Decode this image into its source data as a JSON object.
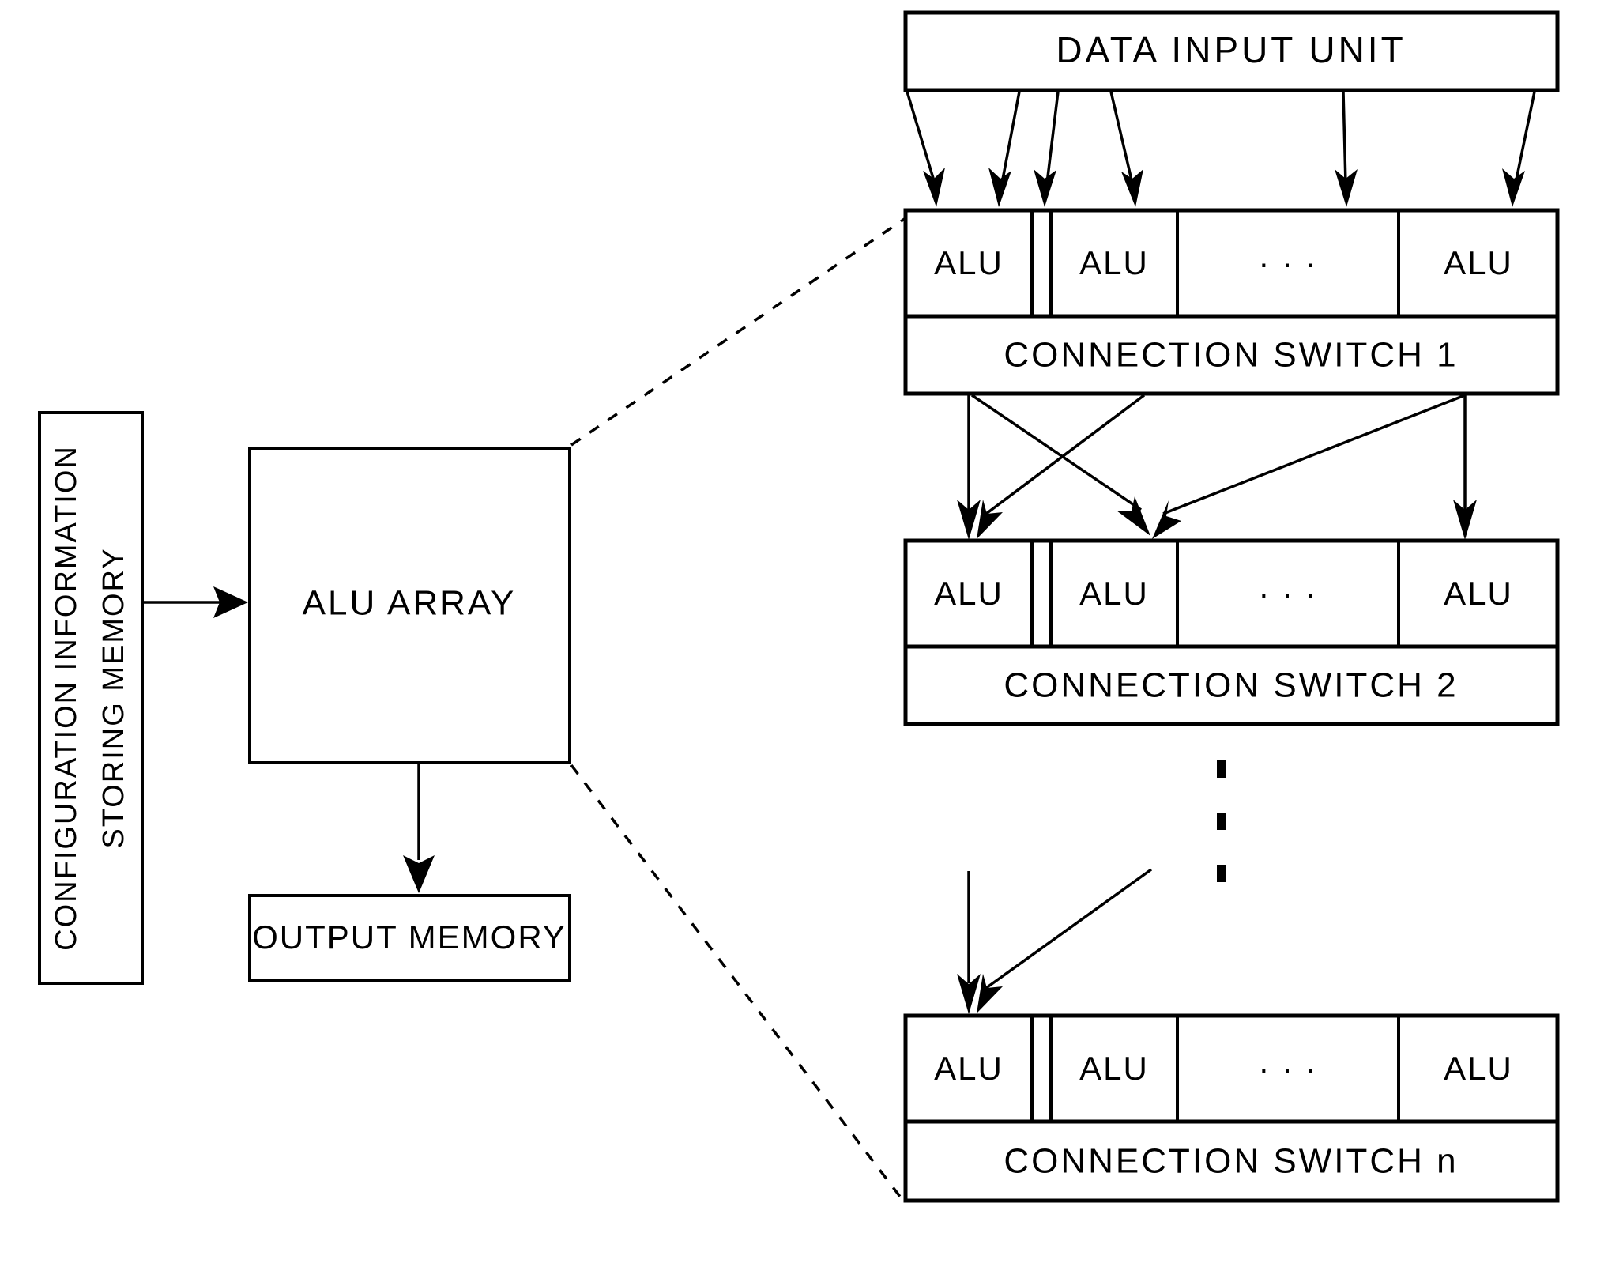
{
  "diagram": {
    "title": "ALU array reconfigurable processor block diagram",
    "colors": {
      "stroke": "#000000",
      "fill": "#ffffff"
    },
    "left": {
      "config_memory": {
        "label_line1": "CONFIGURATION INFORMATION",
        "label_line2": "STORING MEMORY"
      },
      "alu_array": {
        "label": "ALU ARRAY"
      },
      "output_memory": {
        "label": "OUTPUT MEMORY"
      }
    },
    "right": {
      "data_input_unit": {
        "label": "DATA INPUT UNIT"
      },
      "stages": [
        {
          "alus": [
            "ALU",
            "ALU",
            "ALU"
          ],
          "ellipsis": "· · ·",
          "switch_label": "CONNECTION SWITCH 1"
        },
        {
          "alus": [
            "ALU",
            "ALU",
            "ALU"
          ],
          "ellipsis": "· · ·",
          "switch_label": "CONNECTION SWITCH 2"
        },
        {
          "alus": [
            "ALU",
            "ALU",
            "ALU"
          ],
          "ellipsis": "· · ·",
          "switch_label": "CONNECTION SWITCH n"
        }
      ],
      "vertical_ellipsis": "·"
    }
  }
}
